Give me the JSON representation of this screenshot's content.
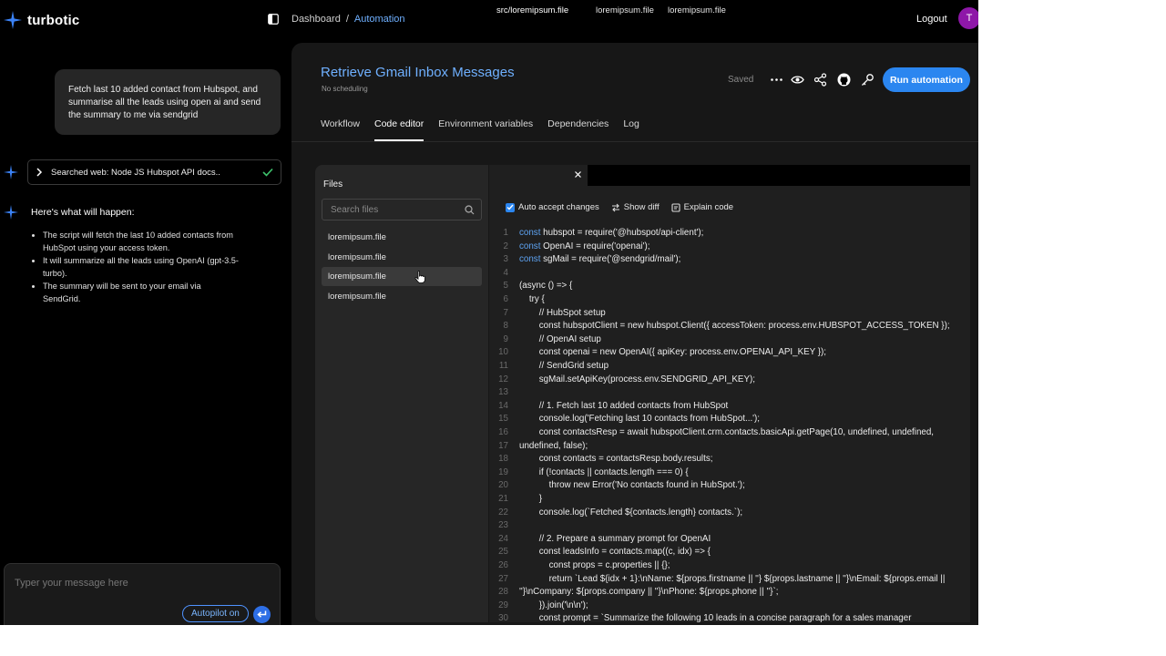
{
  "brand": {
    "name": "turbotic",
    "accent": "#2b86f0"
  },
  "topbar": {
    "breadcrumb": [
      "Dashboard",
      "/",
      "Automation"
    ],
    "logout_label": "Logout",
    "avatar_initial": "T",
    "avatar_color": "#8e17a8"
  },
  "chat": {
    "user_message": "Fetch last 10 added contact from Hubspot, and summarise all the leads using open ai and send the summary to me via sendgrid",
    "search_step": "Searched web: Node JS Hubspot API docs..",
    "plan_title": "Here's what will happen:",
    "plan_items": [
      "The script will fetch the last 10 added contacts from HubSpot using your access token.",
      "It will summarize all the leads using OpenAI (gpt-3.5-turbo).",
      "The summary will be sent to your email via SendGrid."
    ],
    "input_placeholder": "Typer your message here",
    "autopilot_label": "Autopilot on"
  },
  "automation": {
    "title": "Retrieve Gmail Inbox Messages",
    "schedule": "No scheduling",
    "status": "Saved",
    "run_label": "Run automation",
    "toolbar_icons": [
      "more-icon",
      "eye-icon",
      "share-icon",
      "github-icon",
      "key-icon"
    ]
  },
  "tabs": [
    {
      "label": "Workflow",
      "active": false
    },
    {
      "label": "Code editor",
      "active": true
    },
    {
      "label": "Environment variables",
      "active": false
    },
    {
      "label": "Dependencies",
      "active": false
    },
    {
      "label": "Log",
      "active": false
    }
  ],
  "files": {
    "title": "Files",
    "search_placeholder": "Search files",
    "items": [
      "loremipsum.file",
      "loremipsum.file",
      "loremipsum.file",
      "loremipsum.file"
    ],
    "selected_index": 2
  },
  "editor": {
    "tabs": [
      "src/loremipsum.file",
      "loremipsum.file",
      "loremipsum.file"
    ],
    "active_tab": 0,
    "auto_accept_label": "Auto accept changes",
    "show_diff_label": "Show diff",
    "explain_label": "Explain code",
    "lines": [
      {
        "n": "1",
        "kw": "const",
        "t": " hubspot = require('@hubspot/api-client');"
      },
      {
        "n": "2",
        "kw": "const",
        "t": " OpenAI = require('openai');"
      },
      {
        "n": "3",
        "kw": "const",
        "t": " sgMail = require('@sendgrid/mail');"
      },
      {
        "n": "4",
        "kw": "",
        "t": ""
      },
      {
        "n": "5",
        "kw": "",
        "t": "(async () => {"
      },
      {
        "n": "6",
        "kw": "",
        "t": "    try {"
      },
      {
        "n": "7",
        "kw": "",
        "t": "        // HubSpot setup"
      },
      {
        "n": "8",
        "kw": "",
        "t": "        const hubspotClient = new hubspot.Client({ accessToken: process.env.HUBSPOT_ACCESS_TOKEN });"
      },
      {
        "n": "9",
        "kw": "",
        "t": "        // OpenAI setup"
      },
      {
        "n": "10",
        "kw": "",
        "t": "        const openai = new OpenAI({ apiKey: process.env.OPENAI_API_KEY });"
      },
      {
        "n": "11",
        "kw": "",
        "t": "        // SendGrid setup"
      },
      {
        "n": "12",
        "kw": "",
        "t": "        sgMail.setApiKey(process.env.SENDGRID_API_KEY);"
      },
      {
        "n": "13",
        "kw": "",
        "t": ""
      },
      {
        "n": "14",
        "kw": "",
        "t": "        // 1. Fetch last 10 added contacts from HubSpot"
      },
      {
        "n": "15",
        "kw": "",
        "t": "        console.log('Fetching last 10 contacts from HubSpot...');"
      },
      {
        "n": "16",
        "kw": "",
        "t": "        const contactsResp = await hubspotClient.crm.contacts.basicApi.getPage(10, undefined, undefined,"
      },
      {
        "n": "17",
        "kw": "",
        "t": "undefined, false);"
      },
      {
        "n": "18",
        "kw": "",
        "t": "        const contacts = contactsResp.body.results;"
      },
      {
        "n": "19",
        "kw": "",
        "t": "        if (!contacts || contacts.length === 0) {"
      },
      {
        "n": "20",
        "kw": "",
        "t": "            throw new Error('No contacts found in HubSpot.');"
      },
      {
        "n": "21",
        "kw": "",
        "t": "        }"
      },
      {
        "n": "22",
        "kw": "",
        "t": "        console.log(`Fetched ${contacts.length} contacts.`);"
      },
      {
        "n": "23",
        "kw": "",
        "t": ""
      },
      {
        "n": "24",
        "kw": "",
        "t": "        // 2. Prepare a summary prompt for OpenAI"
      },
      {
        "n": "25",
        "kw": "",
        "t": "        const leadsInfo = contacts.map((c, idx) => {"
      },
      {
        "n": "26",
        "kw": "",
        "t": "            const props = c.properties || {};"
      },
      {
        "n": "27",
        "kw": "",
        "t": "            return `Lead ${idx + 1}:\\nName: ${props.firstname || ''} ${props.lastname || ''}\\nEmail: ${props.email ||"
      },
      {
        "n": "28",
        "kw": "",
        "t": "''}\\nCompany: ${props.company || ''}\\nPhone: ${props.phone || ''}`;"
      },
      {
        "n": "29",
        "kw": "",
        "t": "        }).join('\\n\\n');"
      },
      {
        "n": "30",
        "kw": "",
        "t": "        const prompt = `Summarize the following 10 leads in a concise paragraph for a sales manager"
      }
    ]
  }
}
